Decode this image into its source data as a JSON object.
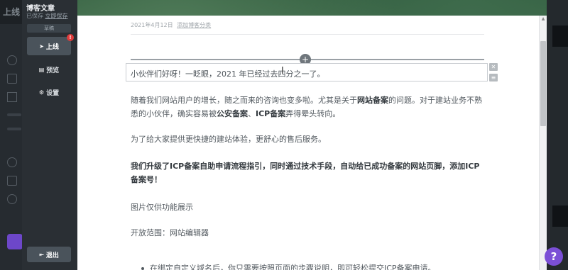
{
  "background_app": {
    "logo": "上线"
  },
  "sidebar": {
    "title": "博客文章",
    "save_status": "已保存",
    "save_now": "立即保存",
    "draft_label": "草稿",
    "publish_label": "上线",
    "publish_badge": "!",
    "preview_label": "预览",
    "settings_label": "设置",
    "exit_label": "退出"
  },
  "editor": {
    "date": "2021年4月12日",
    "add_category": "添加博客分类",
    "add_block_symbol": "+",
    "active_block_text": "小伙伴们好呀！一眨眼，2021 年已经过去四分之一了。",
    "para1_before_1": "随着我们网站用户的增长，随之而来的咨询也变多啦。尤其是关于",
    "para1_bold_1": "网站备案",
    "para1_after_1": "的问题。对于建站业务不熟悉的小伙伴，确实容易被",
    "para1_bold_2": "公安备案",
    "para1_sep": "、",
    "para1_bold_3": "ICP备案",
    "para1_after_2": "弄得晕头转向。",
    "para2": "为了给大家提供更快捷的建站体验，更舒心的售后服务。",
    "para3": "我们升级了ICP备案自助申请流程指引，同时通过技术手段，自动给已成功备案的网站页脚，添加ICP备案号！",
    "para4": "图片仅供功能展示",
    "para5": "开放范围：网站编辑器",
    "bullet1": "在绑定自定义域名后，你只需要按照页面的步骤说明，即可轻松提交ICP备案申请。"
  },
  "help_symbol": "?",
  "colors": {
    "sidebar_bg": "#2a2f34",
    "publish_badge": "#e03b3b",
    "help_button": "#7b4fd6"
  }
}
